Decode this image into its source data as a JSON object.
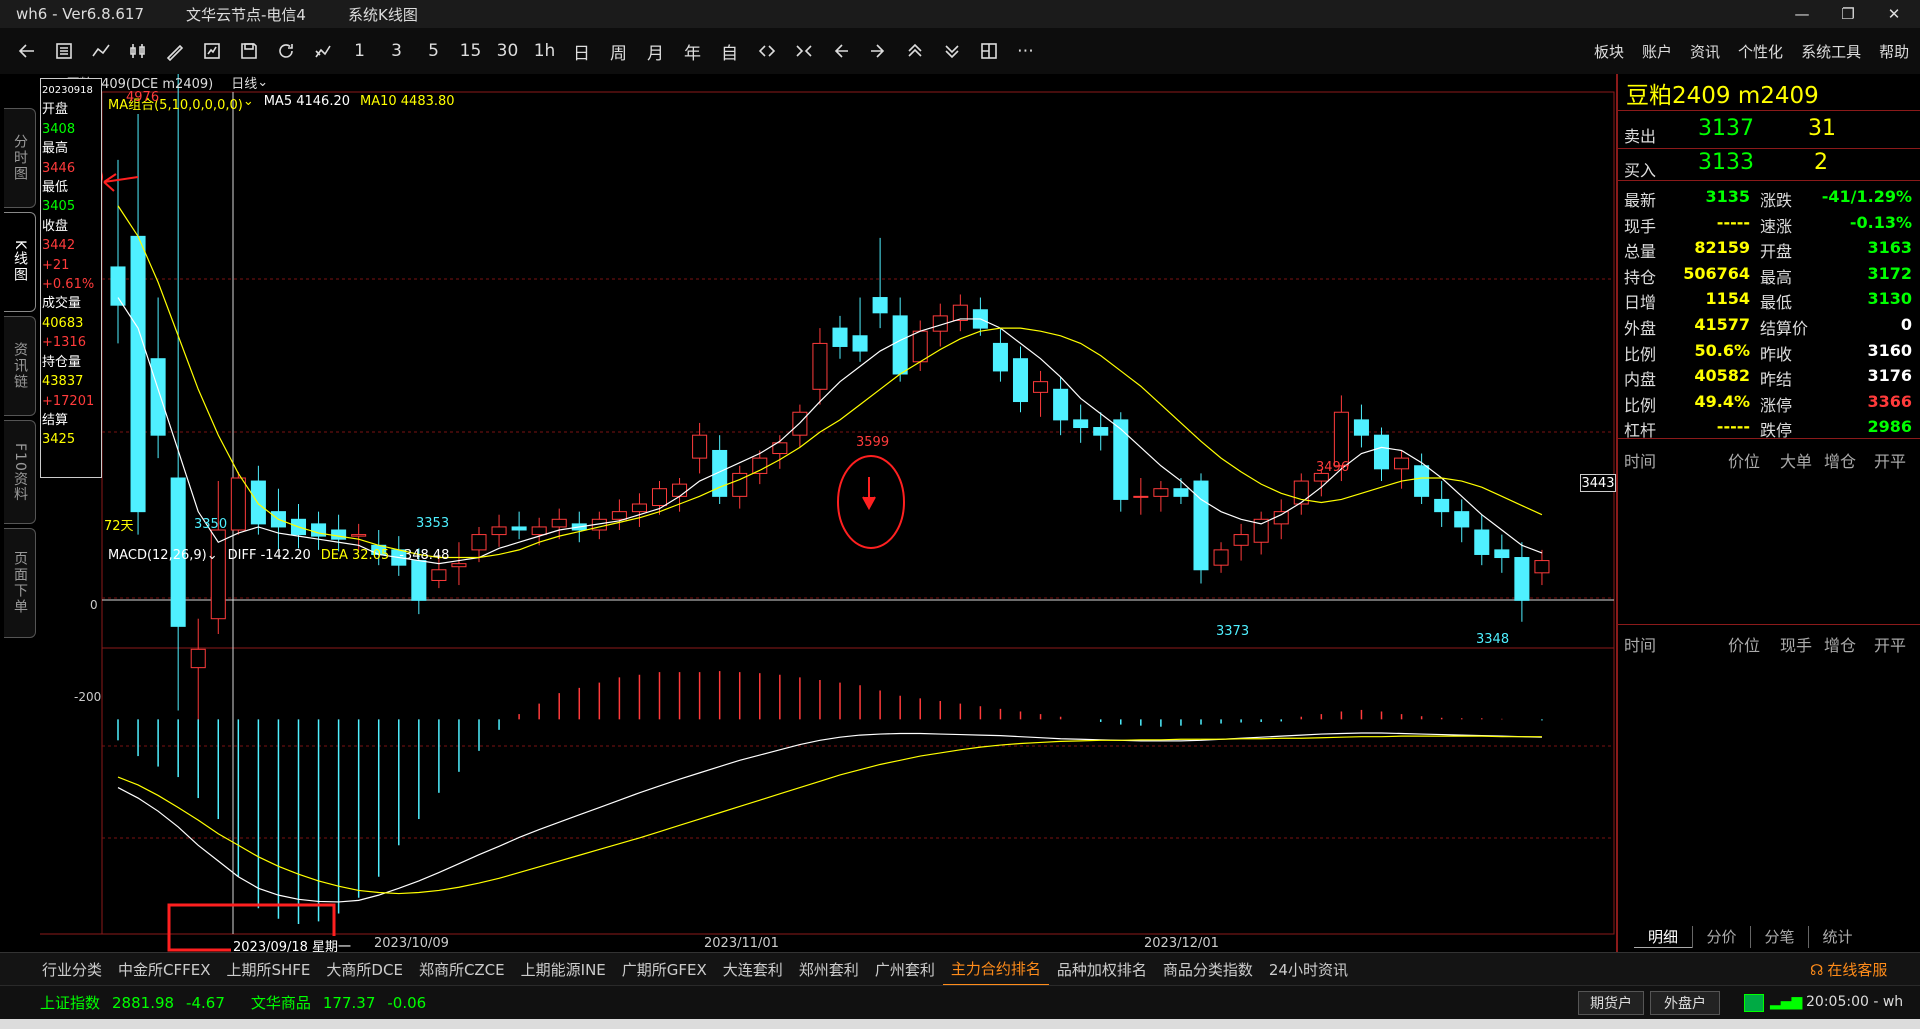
{
  "window": {
    "title": "wh6  -  Ver6.8.617",
    "node": "文华云节点-电信4",
    "mode": "系统K线图"
  },
  "toolbar": {
    "periods": [
      "1",
      "3",
      "5",
      "15",
      "30",
      "1h",
      "日",
      "周",
      "月",
      "年",
      "自"
    ],
    "menu": [
      "板块",
      "账户",
      "资讯",
      "个性化",
      "系统工具",
      "帮助"
    ]
  },
  "sidetabs": [
    "分时图",
    "K线图",
    "资讯链",
    "F10资料",
    "页面下单"
  ],
  "chart": {
    "contract_label": "豆粕2409(DCE m2409)",
    "period_label": "日线",
    "ma_label": "MA组合(5,10,0,0,0,0)",
    "ma5_label": "MA5 4146.20",
    "ma10_label": "MA10 4483.80",
    "days_label": "72天",
    "price_last_label": "3443",
    "annot_high": "4976",
    "annot_3350": "3350",
    "annot_3353": "3353",
    "annot_3599": "3599",
    "annot_3373": "3373",
    "annot_3496": "3496",
    "annot_3348": "3348",
    "macd_label": "MACD(12,26,9)",
    "diff_label": "DIFF -142.20",
    "dea_label": "DEA 32.05",
    "macd_value_label": "-348.48",
    "macd_axis": [
      "0",
      "-200"
    ],
    "date_cursor": "2023/09/18 星期一",
    "date_labels": [
      "2023/10/09",
      "2023/11/01",
      "2023/12/01"
    ]
  },
  "chart_data": {
    "type": "candlestick",
    "ohlc": [
      [
        3580,
        3650,
        3530,
        3555
      ],
      [
        3600,
        3680,
        3405,
        3420
      ],
      [
        3520,
        3560,
        3455,
        3470
      ],
      [
        3442,
        4976,
        3290,
        3345
      ],
      [
        3318,
        3350,
        3280,
        3330
      ],
      [
        3350,
        3440,
        3340,
        3408
      ],
      [
        3408,
        3446,
        3405,
        3442
      ],
      [
        3440,
        3450,
        3405,
        3412
      ],
      [
        3420,
        3435,
        3395,
        3410
      ],
      [
        3415,
        3425,
        3396,
        3405
      ],
      [
        3412,
        3420,
        3395,
        3404
      ],
      [
        3408,
        3418,
        3394,
        3402
      ],
      [
        3404,
        3412,
        3395,
        3405
      ],
      [
        3398,
        3408,
        3385,
        3392
      ],
      [
        3395,
        3404,
        3378,
        3385
      ],
      [
        3388,
        3396,
        3353,
        3362
      ],
      [
        3375,
        3392,
        3370,
        3382
      ],
      [
        3384,
        3400,
        3372,
        3386
      ],
      [
        3395,
        3410,
        3387,
        3405
      ],
      [
        3405,
        3418,
        3397,
        3410
      ],
      [
        3410,
        3420,
        3402,
        3408
      ],
      [
        3405,
        3416,
        3398,
        3410
      ],
      [
        3410,
        3422,
        3402,
        3415
      ],
      [
        3412,
        3420,
        3400,
        3408
      ],
      [
        3408,
        3420,
        3402,
        3415
      ],
      [
        3415,
        3428,
        3408,
        3420
      ],
      [
        3420,
        3432,
        3410,
        3425
      ],
      [
        3424,
        3440,
        3418,
        3435
      ],
      [
        3430,
        3442,
        3420,
        3438
      ],
      [
        3455,
        3478,
        3445,
        3470
      ],
      [
        3460,
        3470,
        3425,
        3430
      ],
      [
        3430,
        3450,
        3422,
        3445
      ],
      [
        3445,
        3460,
        3438,
        3455
      ],
      [
        3458,
        3470,
        3448,
        3465
      ],
      [
        3470,
        3490,
        3462,
        3485
      ],
      [
        3500,
        3540,
        3490,
        3530
      ],
      [
        3540,
        3548,
        3520,
        3528
      ],
      [
        3535,
        3560,
        3518,
        3525
      ],
      [
        3560,
        3599,
        3540,
        3550
      ],
      [
        3548,
        3560,
        3505,
        3510
      ],
      [
        3518,
        3545,
        3512,
        3538
      ],
      [
        3538,
        3556,
        3528,
        3548
      ],
      [
        3545,
        3562,
        3538,
        3555
      ],
      [
        3552,
        3560,
        3535,
        3540
      ],
      [
        3530,
        3540,
        3505,
        3512
      ],
      [
        3520,
        3528,
        3485,
        3492
      ],
      [
        3498,
        3512,
        3482,
        3505
      ],
      [
        3500,
        3508,
        3470,
        3480
      ],
      [
        3480,
        3490,
        3465,
        3475
      ],
      [
        3475,
        3485,
        3460,
        3470
      ],
      [
        3480,
        3485,
        3420,
        3428
      ],
      [
        3430,
        3442,
        3418,
        3430
      ],
      [
        3430,
        3440,
        3420,
        3435
      ],
      [
        3435,
        3442,
        3425,
        3430
      ],
      [
        3440,
        3445,
        3373,
        3382
      ],
      [
        3385,
        3400,
        3380,
        3395
      ],
      [
        3398,
        3412,
        3388,
        3405
      ],
      [
        3400,
        3420,
        3392,
        3415
      ],
      [
        3412,
        3428,
        3402,
        3420
      ],
      [
        3425,
        3445,
        3418,
        3440
      ],
      [
        3440,
        3448,
        3430,
        3445
      ],
      [
        3450,
        3496,
        3440,
        3485
      ],
      [
        3480,
        3490,
        3462,
        3470
      ],
      [
        3470,
        3475,
        3440,
        3448
      ],
      [
        3448,
        3460,
        3435,
        3455
      ],
      [
        3450,
        3458,
        3425,
        3430
      ],
      [
        3428,
        3440,
        3410,
        3420
      ],
      [
        3420,
        3428,
        3400,
        3410
      ],
      [
        3408,
        3418,
        3385,
        3392
      ],
      [
        3395,
        3405,
        3380,
        3390
      ],
      [
        3390,
        3400,
        3348,
        3362
      ],
      [
        3380,
        3395,
        3372,
        3388
      ]
    ],
    "ma5": [
      3560,
      3540,
      3500,
      3460,
      3420,
      3400,
      3406,
      3410,
      3406,
      3404,
      3402,
      3400,
      3398,
      3392,
      3390,
      3388,
      3386,
      3388,
      3390,
      3396,
      3400,
      3404,
      3408,
      3410,
      3412,
      3414,
      3418,
      3422,
      3430,
      3440,
      3446,
      3452,
      3458,
      3466,
      3478,
      3492,
      3505,
      3515,
      3525,
      3532,
      3538,
      3542,
      3546,
      3546,
      3540,
      3530,
      3520,
      3508,
      3494,
      3484,
      3474,
      3462,
      3450,
      3440,
      3428,
      3420,
      3415,
      3412,
      3418,
      3426,
      3436,
      3448,
      3458,
      3462,
      3460,
      3452,
      3442,
      3430,
      3418,
      3408,
      3398,
      3393
    ],
    "ma10": [
      3620,
      3600,
      3570,
      3535,
      3500,
      3470,
      3445,
      3425,
      3415,
      3410,
      3406,
      3404,
      3402,
      3398,
      3395,
      3392,
      3390,
      3390,
      3390,
      3392,
      3395,
      3400,
      3404,
      3407,
      3410,
      3413,
      3416,
      3420,
      3425,
      3430,
      3436,
      3441,
      3447,
      3454,
      3462,
      3472,
      3480,
      3490,
      3500,
      3510,
      3518,
      3526,
      3533,
      3538,
      3540,
      3540,
      3538,
      3535,
      3530,
      3522,
      3512,
      3502,
      3490,
      3478,
      3466,
      3455,
      3446,
      3438,
      3432,
      3428,
      3426,
      3428,
      3432,
      3436,
      3440,
      3442,
      3442,
      3440,
      3436,
      3430,
      3424,
      3418
    ],
    "ylim": [
      3340,
      3680
    ],
    "macd": [
      -40,
      -70,
      -90,
      -110,
      -150,
      -190,
      -300,
      -360,
      -380,
      -390,
      -385,
      -370,
      -340,
      -300,
      -240,
      -190,
      -140,
      -100,
      -60,
      -20,
      10,
      30,
      50,
      60,
      70,
      80,
      85,
      90,
      90,
      90,
      92,
      90,
      88,
      85,
      80,
      75,
      70,
      65,
      55,
      45,
      40,
      35,
      30,
      25,
      20,
      15,
      10,
      5,
      0,
      -5,
      -10,
      -12,
      -14,
      -12,
      -10,
      -8,
      -6,
      -5,
      -4,
      5,
      10,
      15,
      18,
      15,
      10,
      6,
      3,
      2,
      2,
      1,
      0,
      -2
    ],
    "diff": [
      -130,
      -150,
      -175,
      -205,
      -240,
      -270,
      -300,
      -322,
      -335,
      -343,
      -347,
      -348,
      -345,
      -335,
      -322,
      -308,
      -292,
      -275,
      -258,
      -242,
      -225,
      -210,
      -196,
      -182,
      -168,
      -154,
      -140,
      -127,
      -114,
      -102,
      -90,
      -78,
      -68,
      -58,
      -48,
      -40,
      -34,
      -30,
      -28,
      -27,
      -27,
      -28,
      -29,
      -30,
      -31,
      -33,
      -35,
      -37,
      -38,
      -39,
      -40,
      -41,
      -41,
      -41,
      -40,
      -38,
      -36,
      -34,
      -32,
      -30,
      -28,
      -27,
      -26,
      -26,
      -27,
      -28,
      -29,
      -30,
      -31,
      -32,
      -33,
      -34
    ],
    "dea": [
      -110,
      -125,
      -145,
      -168,
      -192,
      -218,
      -240,
      -262,
      -280,
      -295,
      -308,
      -318,
      -326,
      -330,
      -332,
      -330,
      -326,
      -320,
      -312,
      -303,
      -292,
      -281,
      -270,
      -259,
      -248,
      -237,
      -226,
      -214,
      -202,
      -190,
      -178,
      -166,
      -154,
      -142,
      -130,
      -118,
      -106,
      -96,
      -86,
      -78,
      -70,
      -64,
      -58,
      -53,
      -49,
      -46,
      -44,
      -42,
      -41,
      -40,
      -40,
      -39,
      -39,
      -38,
      -38,
      -38,
      -37,
      -37,
      -36,
      -36,
      -35,
      -34,
      -33,
      -33,
      -32,
      -32,
      -32,
      -32,
      -32,
      -33,
      -33,
      -33
    ],
    "macd_ylim": [
      -390,
      115
    ]
  },
  "datapanel": {
    "items": [
      {
        "label": "20230918",
        "value": ""
      },
      {
        "label": "开盘",
        "value": "3408",
        "color": "#00ff00"
      },
      {
        "label": "最高",
        "value": "3446",
        "color": "#ff3b3b"
      },
      {
        "label": "最低",
        "value": "3405",
        "color": "#00ff00"
      },
      {
        "label": "收盘",
        "value": "3442",
        "color": "#ff3b3b"
      },
      {
        "label": "+21",
        "value": "+0.61%",
        "color": "#ff3b3b"
      },
      {
        "label": "成交量",
        "value": "40683",
        "color": "#ffff00"
      },
      {
        "label": "+1316",
        "value": "",
        "color": "#ff3b3b"
      },
      {
        "label": "持仓量",
        "value": "43837",
        "color": "#ffff00"
      },
      {
        "label": "+17201",
        "value": "",
        "color": "#ff3b3b"
      },
      {
        "label": "结算",
        "value": "3425",
        "color": "#ffff00"
      }
    ]
  },
  "quote": {
    "title": "豆粕2409  m2409",
    "sell": {
      "label": "卖出",
      "price": "3137",
      "vol": "31"
    },
    "buy": {
      "label": "买入",
      "price": "3133",
      "vol": "2"
    },
    "rows": [
      {
        "l1": "最新",
        "v1": "3135",
        "c1": "#00ff00",
        "l2": "涨跌",
        "v2": "-41/1.29%",
        "c2": "#00ff00"
      },
      {
        "l1": "现手",
        "v1": "-----",
        "c1": "#ffff00",
        "l2": "速涨",
        "v2": "-0.13%",
        "c2": "#00ff00"
      },
      {
        "l1": "总量",
        "v1": "82159",
        "c1": "#ffff00",
        "l2": "开盘",
        "v2": "3163",
        "c2": "#00ff00"
      },
      {
        "l1": "持仓",
        "v1": "506764",
        "c1": "#ffff00",
        "l2": "最高",
        "v2": "3172",
        "c2": "#00ff00"
      },
      {
        "l1": "日增",
        "v1": "1154",
        "c1": "#ffff00",
        "l2": "最低",
        "v2": "3130",
        "c2": "#00ff00"
      },
      {
        "l1": "外盘",
        "v1": "41577",
        "c1": "#ffff00",
        "l2": "结算价",
        "v2": "0",
        "c2": "#ffffff"
      },
      {
        "l1": "比例",
        "v1": "50.6%",
        "c1": "#ffff00",
        "l2": "昨收",
        "v2": "3160",
        "c2": "#ffffff"
      },
      {
        "l1": "内盘",
        "v1": "40582",
        "c1": "#ffff00",
        "l2": "昨结",
        "v2": "3176",
        "c2": "#ffffff"
      },
      {
        "l1": "比例",
        "v1": "49.4%",
        "c1": "#ffff00",
        "l2": "涨停",
        "v2": "3366",
        "c2": "#ff3b3b"
      },
      {
        "l1": "杠杆",
        "v1": "-----",
        "c1": "#ffff00",
        "l2": "跌停",
        "v2": "2986",
        "c2": "#00ff00"
      }
    ],
    "detail_headers": [
      "时间",
      "价位",
      "大单",
      "增仓",
      "开平"
    ],
    "detail2_headers": [
      "时间",
      "价位",
      "现手",
      "增仓",
      "开平"
    ],
    "tabs": [
      "明细",
      "分价",
      "分笔",
      "统计"
    ]
  },
  "bottom": {
    "tabs": [
      "行业分类",
      "中金所CFFEX",
      "上期所SHFE",
      "大商所DCE",
      "郑商所CZCE",
      "上期能源INE",
      "广期所GFEX",
      "大连套利",
      "郑州套利",
      "广州套利",
      "主力合约排名",
      "品种加权排名",
      "商品分类指数",
      "24小时资讯"
    ],
    "online": "在线客服"
  },
  "status": {
    "index1_name": "上证指数",
    "index1_val": "2881.98",
    "index1_chg": "-4.67",
    "index2_name": "文华商品",
    "index2_val": "177.37",
    "index2_chg": "-0.06",
    "futures_btn": "期货户",
    "stock_btn": "外盘户",
    "time": "20:05:00 - wh"
  }
}
